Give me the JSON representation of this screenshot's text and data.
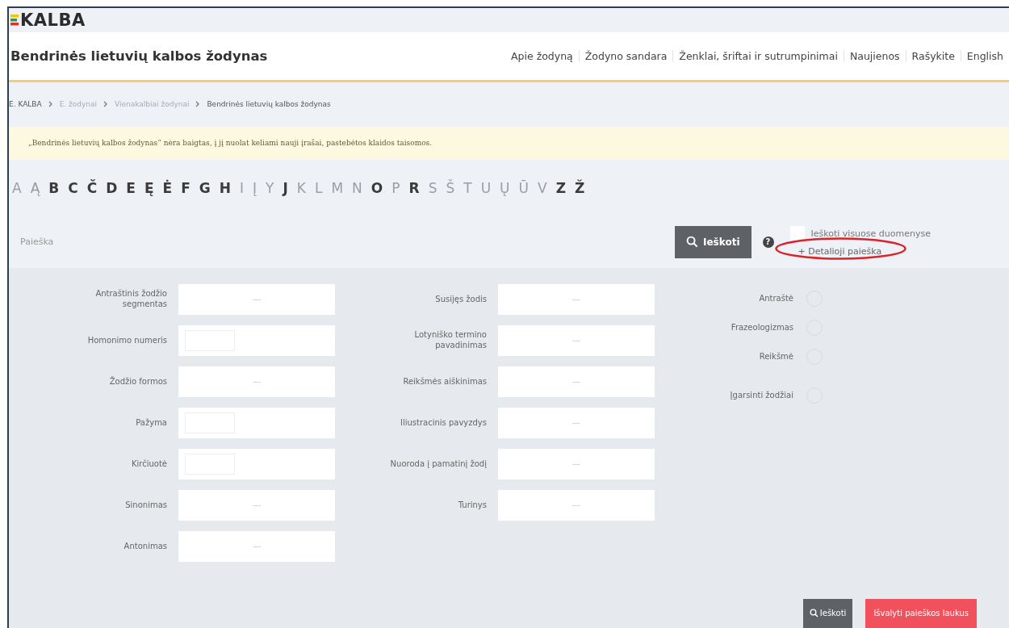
{
  "logo": {
    "text": "KALBA"
  },
  "header": {
    "title": "Bendrinės lietuvių kalbos žodynas",
    "nav": [
      "Apie žodyną",
      "Žodyno sandara",
      "Ženklai, šriftai ir sutrumpinimai",
      "Naujienos",
      "Rašykite",
      "English"
    ]
  },
  "breadcrumb": [
    "E. KALBA",
    "E. žodynai",
    "Vienakalbiai žodynai",
    "Bendrinės lietuvių kalbos žodynas"
  ],
  "notice": "„Bendrinės lietuvių kalbos žodynas“ nėra baigtas, į jį nuolat keliami nauji įrašai, pastebėtos klaidos taisomos.",
  "alphabet": [
    {
      "letter": "A",
      "disabled": true
    },
    {
      "letter": "Ą",
      "disabled": true
    },
    {
      "letter": "B",
      "disabled": false
    },
    {
      "letter": "C",
      "disabled": false
    },
    {
      "letter": "Č",
      "disabled": false
    },
    {
      "letter": "D",
      "disabled": false
    },
    {
      "letter": "E",
      "disabled": false
    },
    {
      "letter": "Ę",
      "disabled": false
    },
    {
      "letter": "Ė",
      "disabled": false
    },
    {
      "letter": "F",
      "disabled": false
    },
    {
      "letter": "G",
      "disabled": false
    },
    {
      "letter": "H",
      "disabled": false
    },
    {
      "letter": "I",
      "disabled": true
    },
    {
      "letter": "Į",
      "disabled": true
    },
    {
      "letter": "Y",
      "disabled": true
    },
    {
      "letter": "J",
      "disabled": false
    },
    {
      "letter": "K",
      "disabled": true
    },
    {
      "letter": "L",
      "disabled": true
    },
    {
      "letter": "M",
      "disabled": true
    },
    {
      "letter": "N",
      "disabled": true
    },
    {
      "letter": "O",
      "disabled": false
    },
    {
      "letter": "P",
      "disabled": true
    },
    {
      "letter": "R",
      "disabled": false
    },
    {
      "letter": "S",
      "disabled": true
    },
    {
      "letter": "Š",
      "disabled": true
    },
    {
      "letter": "T",
      "disabled": true
    },
    {
      "letter": "U",
      "disabled": true
    },
    {
      "letter": "Ų",
      "disabled": true
    },
    {
      "letter": "Ū",
      "disabled": true
    },
    {
      "letter": "V",
      "disabled": true
    },
    {
      "letter": "Z",
      "disabled": false
    },
    {
      "letter": "Ž",
      "disabled": false
    }
  ],
  "search": {
    "placeholder": "Paieška",
    "button": "Ieškoti",
    "help": "?",
    "all_data": {
      "label": "Ieškoti visuose duomenyse",
      "checked": false
    },
    "advanced_link": "+ Detalioji paieška",
    "advanced_link_circled": true
  },
  "advanced": {
    "columns": [
      [
        {
          "label": "Antraštinis žodžio segmentas",
          "kind": "text",
          "placeholder": "---"
        },
        {
          "label": "Homonimo numeris",
          "kind": "small"
        },
        {
          "label": "Žodžio formos",
          "kind": "text",
          "placeholder": "---"
        },
        {
          "label": "Pažyma",
          "kind": "small"
        },
        {
          "label": "Kirčiuotė",
          "kind": "small"
        },
        {
          "label": "Sinonimas",
          "kind": "text",
          "placeholder": "---"
        },
        {
          "label": "Antonimas",
          "kind": "text",
          "placeholder": "---"
        }
      ],
      [
        {
          "label": "Susijęs žodis",
          "kind": "text",
          "placeholder": "---"
        },
        {
          "label": "Lotyniško termino pavadinimas",
          "kind": "text",
          "placeholder": "---"
        },
        {
          "label": "Reikšmės aiškinimas",
          "kind": "text",
          "placeholder": "---"
        },
        {
          "label": "Iliustracinis pavyzdys",
          "kind": "text",
          "placeholder": "---"
        },
        {
          "label": "Nuoroda į pamatinį žodį",
          "kind": "text",
          "placeholder": "---"
        },
        {
          "label": "Turinys",
          "kind": "text",
          "placeholder": "---"
        }
      ]
    ],
    "scope": [
      {
        "label": "Antraštė",
        "selected": false
      },
      {
        "label": "Frazeologizmas",
        "selected": false
      },
      {
        "label": "Reikšmė",
        "selected": false
      },
      {
        "label": "Įgarsinti žodžiai",
        "selected": false
      }
    ],
    "search_button": "Ieškoti",
    "clear_button": "Išvalyti paieškos laukus"
  }
}
